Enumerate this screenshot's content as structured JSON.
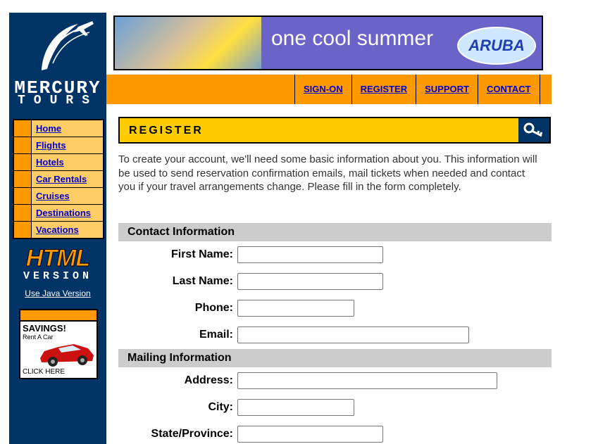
{
  "brand": {
    "name_line1": "MERCURY",
    "name_line2": "TOURS"
  },
  "sidebar": {
    "items": [
      {
        "label": "Home"
      },
      {
        "label": "Flights"
      },
      {
        "label": "Hotels"
      },
      {
        "label": "Car Rentals"
      },
      {
        "label": "Cruises"
      },
      {
        "label": "Destinations"
      },
      {
        "label": "Vacations"
      }
    ],
    "html_badge": {
      "big": "HTML",
      "small": "VERSION"
    },
    "java_link": "Use Java Version",
    "ad": {
      "title": "SAVINGS!",
      "subtitle": "Rent A Car",
      "cta": "CLICK HERE"
    }
  },
  "banner": {
    "text": "one cool summer",
    "badge": "ARUBA"
  },
  "topnav": {
    "items": [
      "SIGN-ON",
      "REGISTER",
      "SUPPORT",
      "CONTACT"
    ]
  },
  "register": {
    "title": "REGISTER",
    "intro": "To create your account, we'll need some basic information about you. This information will be used to send reservation confirmation emails, mail tickets when needed and contact you if your travel arrangements change. Please fill in the form completely."
  },
  "form": {
    "contact_header": "Contact Information",
    "mailing_header": "Mailing Information",
    "fields": {
      "first_name": {
        "label": "First Name:",
        "value": ""
      },
      "last_name": {
        "label": "Last Name:",
        "value": ""
      },
      "phone": {
        "label": "Phone:",
        "value": ""
      },
      "email": {
        "label": "Email:",
        "value": ""
      },
      "address": {
        "label": "Address:",
        "value": ""
      },
      "city": {
        "label": "City:",
        "value": ""
      },
      "state": {
        "label": "State/Province:",
        "value": ""
      }
    }
  },
  "colors": {
    "sidebar": "#003366",
    "orange": "#ff9900",
    "yellow": "#ffcc00",
    "link": "#0000cc",
    "section": "#cccccc"
  }
}
